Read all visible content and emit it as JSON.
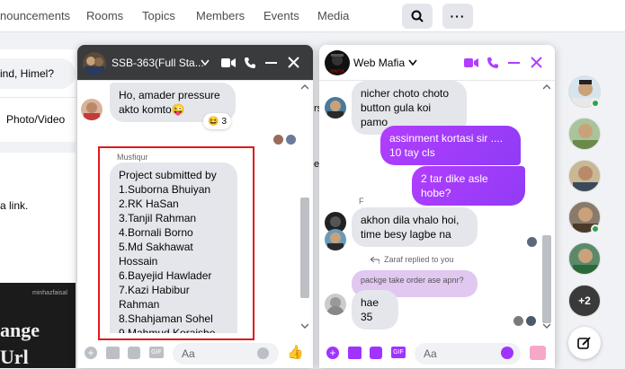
{
  "topnav": {
    "tabs": [
      "nouncements",
      "Rooms",
      "Topics",
      "Members",
      "Events",
      "Media"
    ],
    "search_icon": "search-icon",
    "more_icon": "more-icon"
  },
  "left": {
    "search_fragment": "ind, Himel?",
    "photo_video": "Photo/Video",
    "link_text": "a link.",
    "img_caption": "minhazfaisal",
    "img_big1": "ange",
    "img_big2": "Url"
  },
  "chat1": {
    "title": "SSB-363(Full Sta...",
    "msg1": "Ho,  amader pressure akto komto😜",
    "reaction_count": "3",
    "sender": "Musfiqur",
    "submission": "Project submitted by\n1.Suborna Bhuiyan\n2.RK HaSan\n3.Tanjil Rahman\n4.Bornali Borno\n5.Md Sakhawat Hossain\n6.Bayejid Hawlader\n7.Kazi Habibur Rahman\n8.Shahjaman Sohel\n9.Mahmud Koraishe",
    "input_placeholder": "Aa"
  },
  "between": {
    "frag_rs": "rs",
    "frag_el": "el"
  },
  "chat2": {
    "title": "Web Mafia",
    "msg_in1": "nicher choto choto button gula koi pamo",
    "msg_out1": "assinment kortasi sir .... 10 tay cls",
    "msg_out2": "2 tar dike asle hobe?",
    "sender_initial": "F",
    "msg_in2": "akhon dila vhalo hoi, time besy lagbe na",
    "replied_note": "Zaraf replied to you",
    "quoted": "packge take order ase apnr?",
    "msg_in3": "hae 35",
    "input_placeholder": "Aa"
  },
  "sidebar": {
    "more_count": "+2"
  },
  "colors": {
    "accent": "#a033ff",
    "highlight": "#e0191d",
    "online": "#31a24c"
  }
}
